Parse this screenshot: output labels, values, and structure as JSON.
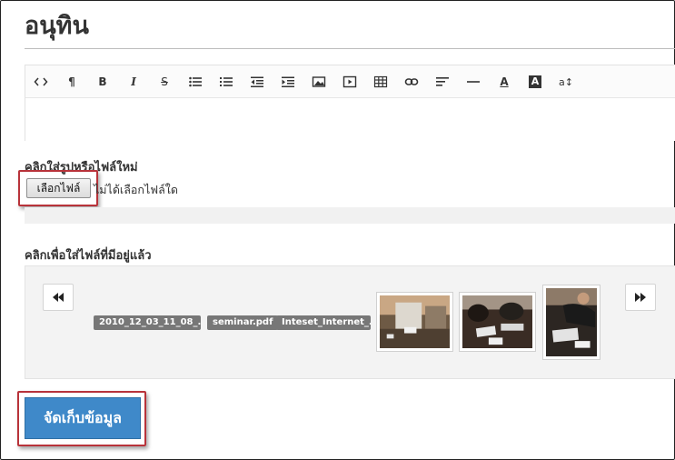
{
  "page": {
    "title": "อนุทิน"
  },
  "editor": {
    "toolbar": [
      {
        "name": "code-view-icon",
        "glyph": "<>"
      },
      {
        "name": "paragraph-icon",
        "glyph": "¶"
      },
      {
        "name": "bold-icon",
        "glyph": "B"
      },
      {
        "name": "italic-icon",
        "glyph": "I"
      },
      {
        "name": "strikethrough-icon",
        "glyph": "S"
      },
      {
        "name": "unordered-list-icon",
        "glyph": ""
      },
      {
        "name": "ordered-list-icon",
        "glyph": ""
      },
      {
        "name": "outdent-icon",
        "glyph": ""
      },
      {
        "name": "indent-icon",
        "glyph": ""
      },
      {
        "name": "image-icon",
        "glyph": ""
      },
      {
        "name": "video-icon",
        "glyph": ""
      },
      {
        "name": "table-icon",
        "glyph": ""
      },
      {
        "name": "link-icon",
        "glyph": ""
      },
      {
        "name": "align-icon",
        "glyph": ""
      },
      {
        "name": "horizontal-rule-icon",
        "glyph": ""
      },
      {
        "name": "font-color-icon",
        "glyph": "A"
      },
      {
        "name": "background-color-icon",
        "glyph": "A"
      },
      {
        "name": "font-size-icon",
        "glyph": "a↕"
      }
    ]
  },
  "upload": {
    "label": "คลิกใส่รูปหรือไฟล์ใหม่",
    "button_label": "เลือกไฟล์",
    "status": "ไม่ได้เลือกไฟล์ใด"
  },
  "existing": {
    "label": "คลิกเพื่อใส่ไฟล์ที่มีอยู่แล้ว",
    "files": [
      "2010_12_03_11_08_...",
      "seminar.pdf",
      "Inteset_Internet_..."
    ]
  },
  "actions": {
    "save_label": "จัดเก็บข้อมูล"
  },
  "colors": {
    "accent": "#3f89c9",
    "highlight": "#b8333a",
    "chip": "#777777"
  }
}
